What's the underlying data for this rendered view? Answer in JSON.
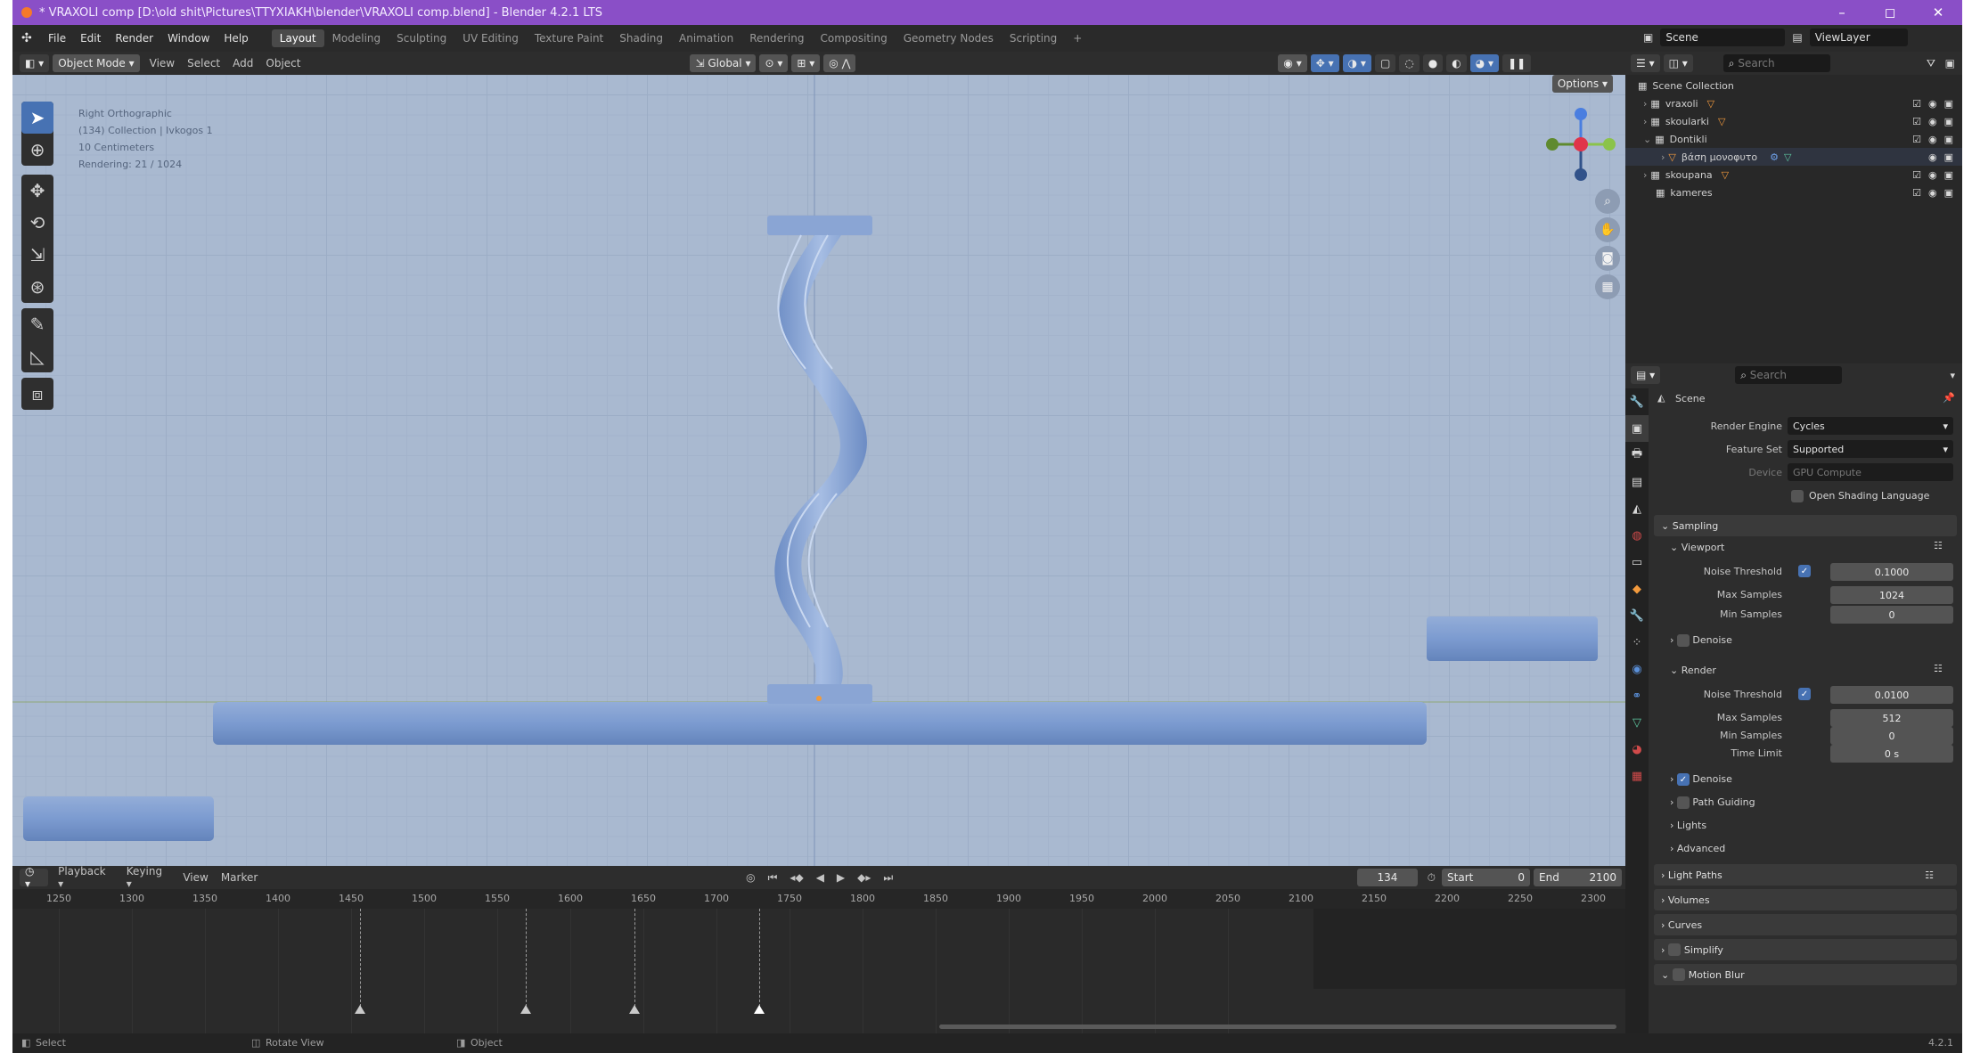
{
  "window": {
    "title": "* VRAXOLI comp [D:\\old shit\\Pictures\\TTYXIAKH\\blender\\VRAXOLI comp.blend] - Blender 4.2.1 LTS",
    "controls": [
      "–",
      "◻",
      "✕"
    ]
  },
  "menu": {
    "items": [
      "File",
      "Edit",
      "Render",
      "Window",
      "Help"
    ],
    "workspaces": [
      "Layout",
      "Modeling",
      "Sculpting",
      "UV Editing",
      "Texture Paint",
      "Shading",
      "Animation",
      "Rendering",
      "Compositing",
      "Geometry Nodes",
      "Scripting",
      "+"
    ],
    "active_workspace": "Layout",
    "scene": "Scene",
    "view_layer": "ViewLayer"
  },
  "viewport_header": {
    "mode": "Object Mode",
    "menus": [
      "View",
      "Select",
      "Add",
      "Object"
    ],
    "orientation": "Global",
    "options": "Options"
  },
  "viewport_info": {
    "lines": [
      "Right Orthographic",
      "(134) Collection | Ivkogos 1",
      "10 Centimeters",
      "Rendering: 21 / 1024"
    ]
  },
  "timeline": {
    "menus": [
      "Playback",
      "Keying",
      "View",
      "Marker"
    ],
    "current_frame": "134",
    "start_label": "Start",
    "start": "0",
    "end_label": "End",
    "end": "2100",
    "ruler": [
      "1250",
      "1300",
      "1350",
      "1400",
      "1450",
      "1500",
      "1550",
      "1600",
      "1650",
      "1700",
      "1750",
      "1800",
      "1850",
      "1900",
      "1950",
      "2000",
      "2050",
      "2100",
      "2150",
      "2200",
      "2250",
      "2300"
    ]
  },
  "status": {
    "select": "Select",
    "rotate": "Rotate View",
    "object": "Object",
    "version": "4.2.1"
  },
  "outliner": {
    "root": "Scene Collection",
    "search_placeholder": "Search",
    "items": [
      {
        "name": "vraxoli",
        "depth": 1
      },
      {
        "name": "skoularki",
        "depth": 1
      },
      {
        "name": "Dontikli",
        "depth": 1
      },
      {
        "name": "βάση μονοφυτο",
        "depth": 2
      },
      {
        "name": "skoupana",
        "depth": 1
      },
      {
        "name": "kameres",
        "depth": 1
      }
    ]
  },
  "properties": {
    "search_placeholder": "Search",
    "scene_name": "Scene",
    "render_engine_label": "Render Engine",
    "render_engine": "Cycles",
    "feature_set_label": "Feature Set",
    "feature_set": "Supported",
    "device_label": "Device",
    "device": "GPU Compute",
    "osl": "Open Shading Language",
    "sampling": "Sampling",
    "viewport": "Viewport",
    "vp_noise_label": "Noise Threshold",
    "vp_noise": "0.1000",
    "vp_max_label": "Max Samples",
    "vp_max": "1024",
    "vp_min_label": "Min Samples",
    "vp_min": "0",
    "denoise": "Denoise",
    "render": "Render",
    "r_noise_label": "Noise Threshold",
    "r_noise": "0.0100",
    "r_max_label": "Max Samples",
    "r_max": "512",
    "r_min_label": "Min Samples",
    "r_min": "0",
    "time_limit_label": "Time Limit",
    "time_limit": "0 s",
    "r_denoise": "Denoise",
    "path_guiding": "Path Guiding",
    "lights": "Lights",
    "advanced": "Advanced",
    "light_paths": "Light Paths",
    "volumes": "Volumes",
    "curves": "Curves",
    "simplify": "Simplify",
    "motion_blur": "Motion Blur"
  },
  "colors": {
    "accent": "#4772b3",
    "titlebar": "#8a4fc7",
    "viewport_bg": "#a9b9d0",
    "object": "#7f9ccf"
  }
}
